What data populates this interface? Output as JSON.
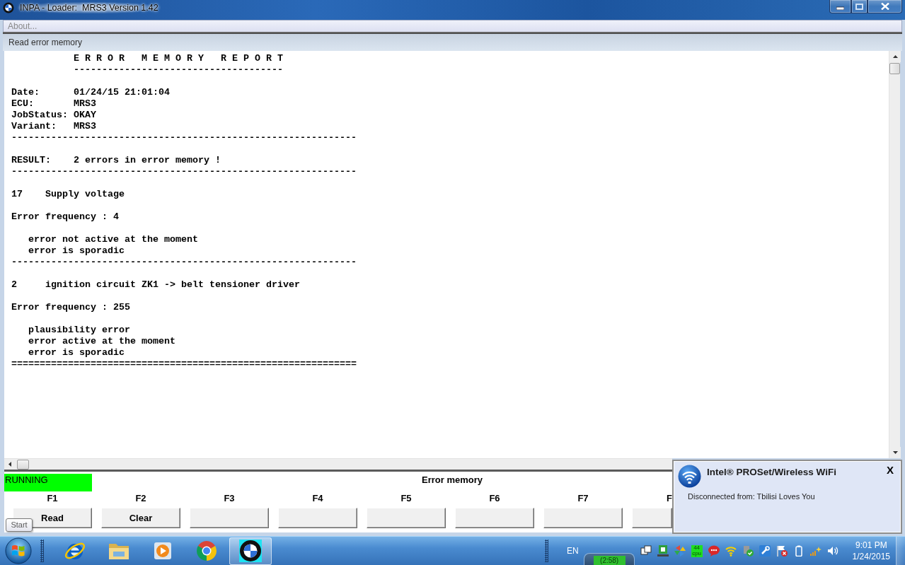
{
  "window": {
    "title": "INPA - Loader:  MRS3 Version 1.42"
  },
  "menu": [
    {
      "label": "About...",
      "disabled": true
    }
  ],
  "panel": {
    "title": "Read error memory"
  },
  "report": {
    "title": "E R R O R   M E M O R Y   R E P O R T",
    "title_rule": "-------------------------------------",
    "fields": [
      {
        "label": "Date:",
        "value": "01/24/15 21:01:04"
      },
      {
        "label": "ECU:",
        "value": "MRS3"
      },
      {
        "label": "JobStatus:",
        "value": "OKAY"
      },
      {
        "label": "Variant:",
        "value": "MRS3"
      }
    ],
    "fields_rule": "-------------------------------------------------------------",
    "result": {
      "label": "RESULT:",
      "value": "2 errors in error memory !"
    },
    "result_rule": "-------------------------------------------------------------",
    "errors": [
      {
        "code": "17",
        "description": "Supply voltage",
        "frequency": "Error frequency : 4",
        "details": [
          "error not active at the moment",
          "error is sporadic"
        ],
        "rule": "-------------------------------------------------------------"
      },
      {
        "code": "2",
        "description": "ignition circuit ZK1 -> belt tensioner driver",
        "frequency": "Error frequency : 255",
        "details": [
          "plausibility error",
          "error active at the moment",
          "error is sporadic"
        ],
        "rule": "============================================================="
      }
    ]
  },
  "status": {
    "state": "RUNNING",
    "title": "Error memory"
  },
  "function_keys": [
    {
      "key": "F1",
      "label": "Read"
    },
    {
      "key": "F2",
      "label": "Clear"
    },
    {
      "key": "F3"
    },
    {
      "key": "F4"
    },
    {
      "key": "F5"
    },
    {
      "key": "F6"
    },
    {
      "key": "F7"
    },
    {
      "key": "F"
    }
  ],
  "tooltip": {
    "text": "Start"
  },
  "notification": {
    "title": "Intel® PROSet/Wireless WiFi",
    "message": "Disconnected from: Tbilisi Loves You",
    "close": "X"
  },
  "taskbar": {
    "apps": [
      {
        "selected": false
      },
      {
        "selected": false
      },
      {
        "selected": false
      },
      {
        "selected": false
      },
      {
        "selected": true
      }
    ],
    "language": "EN",
    "gadget": "(2:58)",
    "cpu_meter": {
      "value": "44",
      "unit": "cpu"
    },
    "clock": {
      "time": "9:01 PM",
      "date": "1/24/2015"
    }
  }
}
